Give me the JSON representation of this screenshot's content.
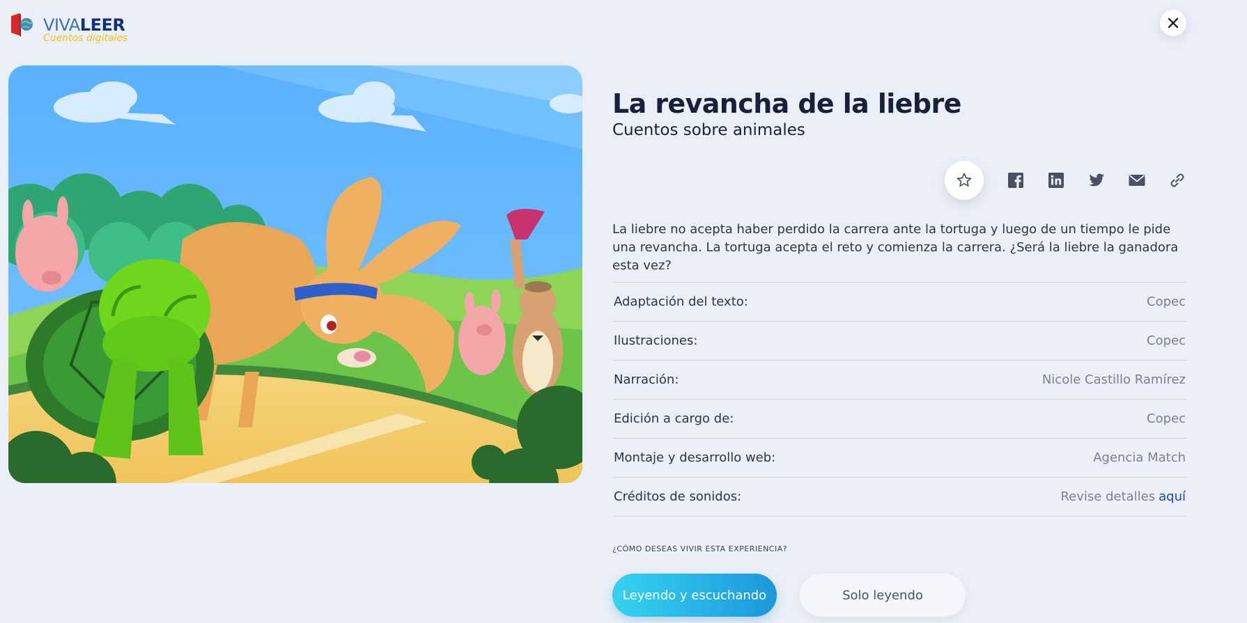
{
  "logo": {
    "brand_part1": "VIVA",
    "brand_part2": "LEER",
    "tagline": "Cuentos digitales"
  },
  "story": {
    "title": "La revancha de la liebre",
    "category": "Cuentos sobre animales",
    "description": "La liebre no acepta haber perdido la carrera ante la tortuga y luego de un tiempo le pide una revancha. La tortuga acepta el reto y comienza la carrera. ¿Será la liebre la ganadora esta vez?"
  },
  "actions": {
    "favorite_icon": "star-icon",
    "share_icons": [
      "facebook-icon",
      "linkedin-icon",
      "twitter-icon",
      "email-icon",
      "link-icon"
    ]
  },
  "credits": [
    {
      "label": "Adaptación del texto:",
      "value": "Copec"
    },
    {
      "label": "Ilustraciones:",
      "value": "Copec"
    },
    {
      "label": "Narración:",
      "value": "Nicole Castillo Ramírez"
    },
    {
      "label": "Edición a cargo de:",
      "value": "Copec"
    },
    {
      "label": "Montaje y desarrollo web:",
      "value": "Agencia Match"
    },
    {
      "label": "Créditos de sonidos:",
      "value": "Revise detalles",
      "link": "aquí"
    }
  ],
  "experience": {
    "question": "¿CÓMO DESEAS VIVIR ESTA EXPERIENCIA?",
    "option_listen": "Leyendo y escuchando",
    "option_read": "Solo leyendo"
  },
  "colors": {
    "background": "#ebeff7",
    "title": "#17213a",
    "primary_gradient_start": "#35d3f0",
    "primary_gradient_end": "#1c97dc",
    "link": "#1f3fbf",
    "logo_tagline": "#f2c21a"
  }
}
